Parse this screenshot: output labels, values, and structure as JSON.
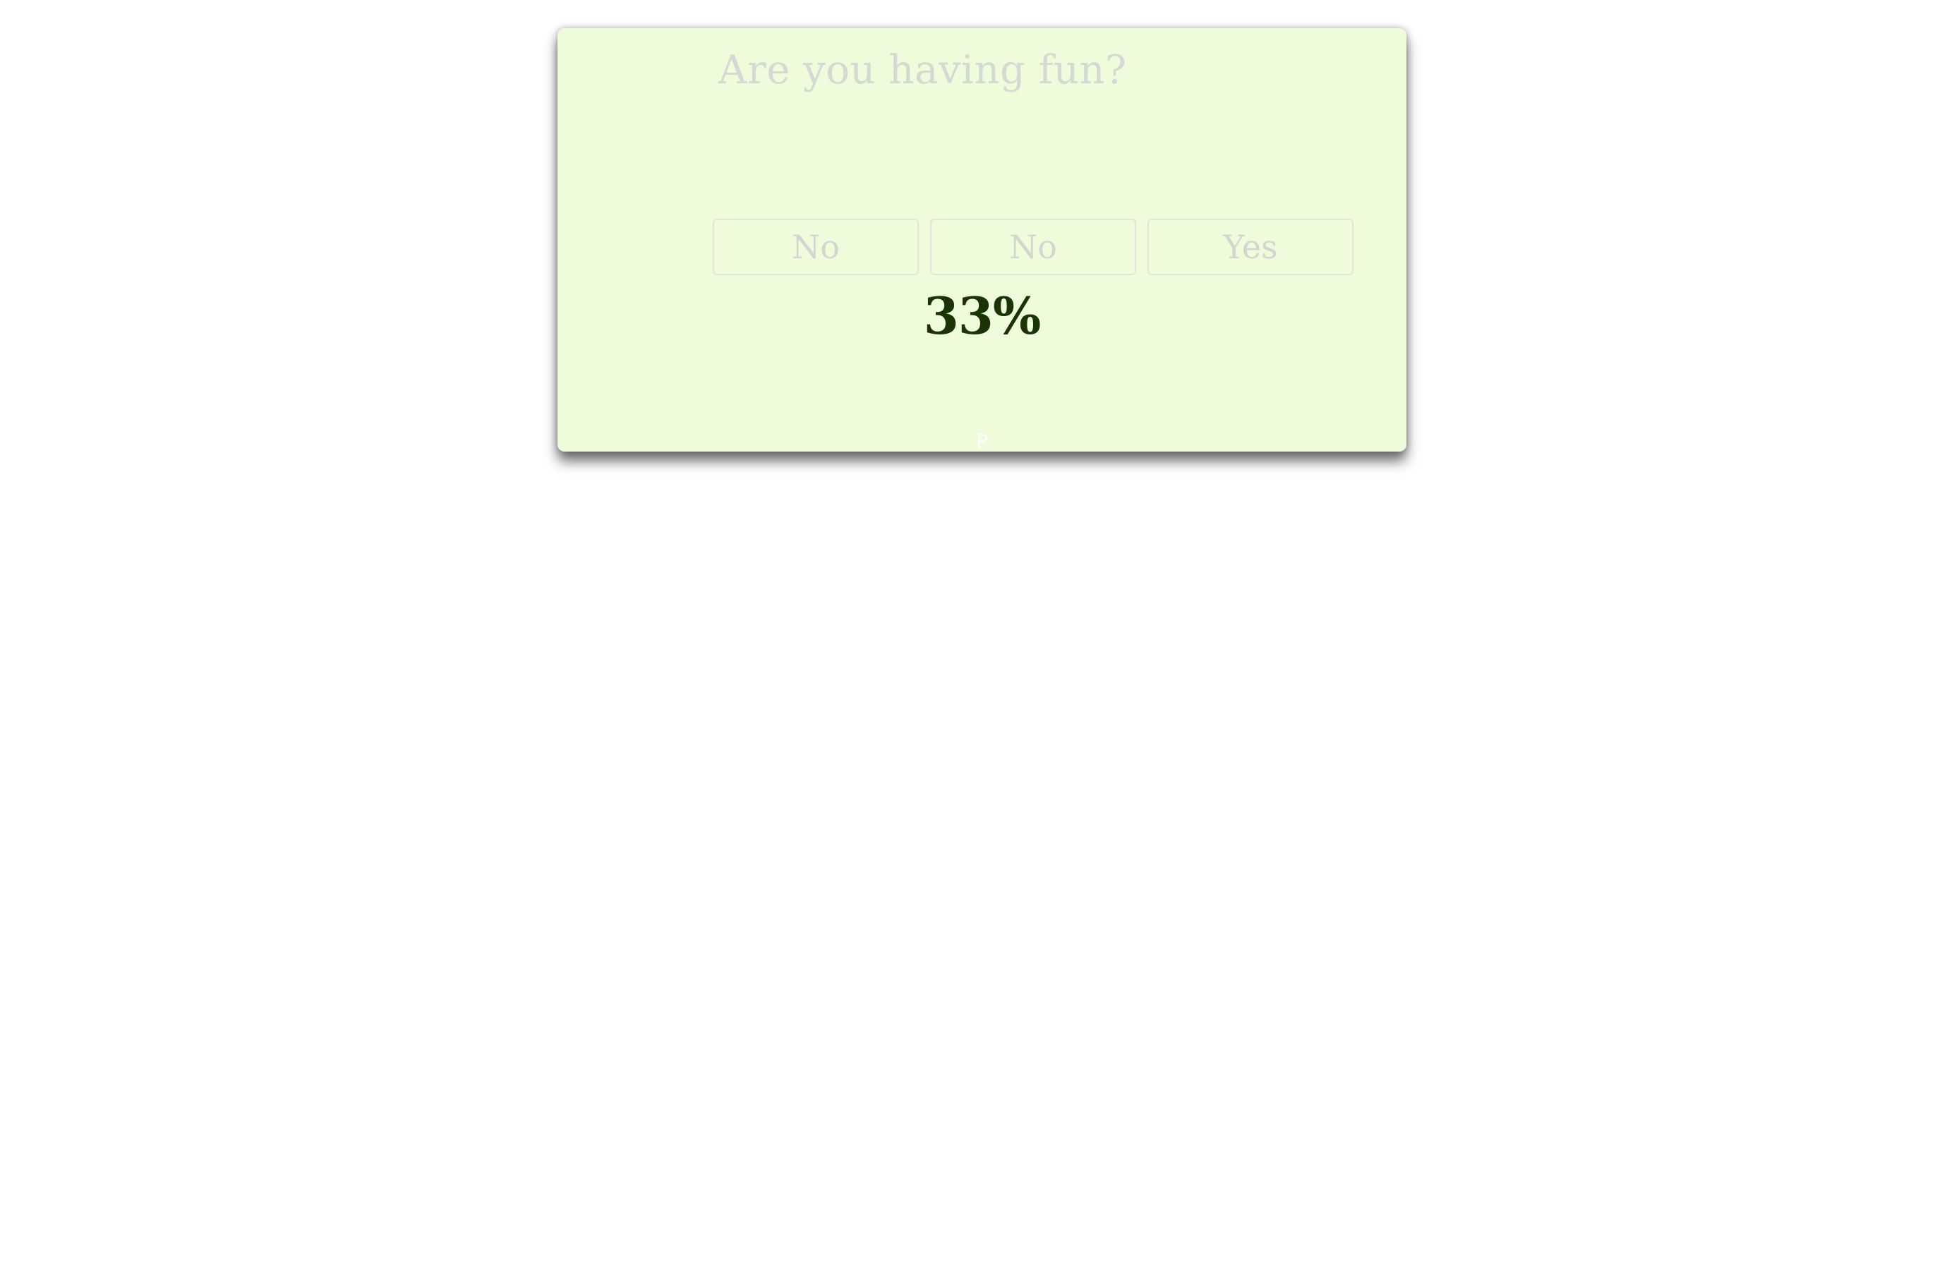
{
  "quiz": {
    "question": "Are you having fun?",
    "answers": [
      {
        "label": "No"
      },
      {
        "label": "No"
      },
      {
        "label": "Yes"
      }
    ],
    "progress_text": "33%",
    "footer_mark": "P"
  },
  "colors": {
    "card_background": "#eefcdb",
    "progress_text": "#1a3406",
    "faded_text": "#d6d8d2"
  }
}
